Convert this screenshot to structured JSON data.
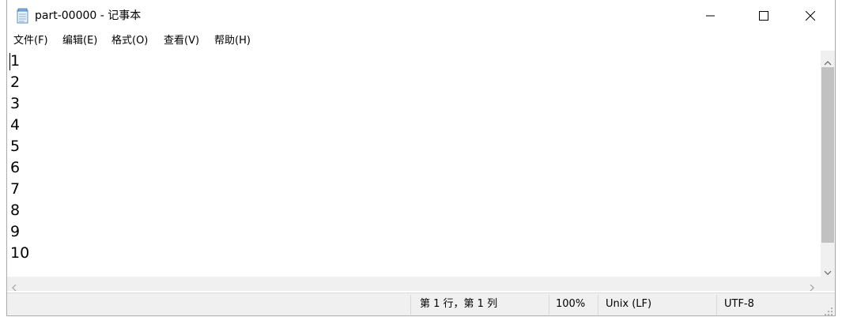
{
  "window": {
    "title": "part-00000 - 记事本",
    "minimize_label": "Minimize",
    "maximize_label": "Maximize",
    "close_label": "Close"
  },
  "menu": {
    "items": [
      {
        "label": "文件(F)",
        "accel": "F"
      },
      {
        "label": "编辑(E)",
        "accel": "E"
      },
      {
        "label": "格式(O)",
        "accel": "O"
      },
      {
        "label": "查看(V)",
        "accel": "V"
      },
      {
        "label": "帮助(H)",
        "accel": "H"
      }
    ]
  },
  "editor": {
    "lines": [
      "1",
      "2",
      "3",
      "4",
      "5",
      "6",
      "7",
      "8",
      "9",
      "10"
    ]
  },
  "statusbar": {
    "position": "第 1 行，第 1 列",
    "zoom": "100%",
    "line_ending": "Unix (LF)",
    "encoding": "UTF-8"
  },
  "icons": {
    "app": "notepad-icon",
    "minimize": "minimize-icon",
    "maximize": "maximize-icon",
    "close": "close-icon"
  },
  "colors": {
    "scrollbar_track": "#f0f0f0",
    "scrollbar_thumb": "#c1c1c1",
    "statusbar_bg": "#f0f0f0"
  }
}
